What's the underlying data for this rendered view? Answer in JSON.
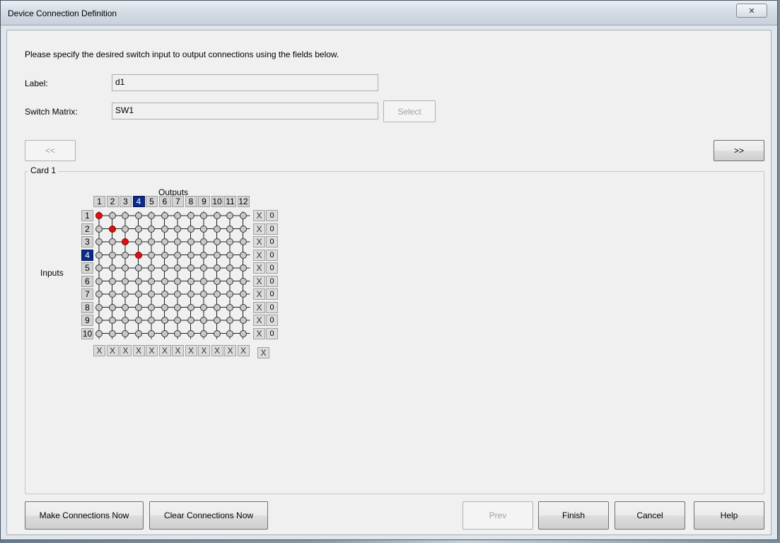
{
  "window": {
    "title": "Device Connection Definition",
    "close_glyph": "✕"
  },
  "instruction": "Please specify the desired switch input to output connections using the fields below.",
  "form": {
    "label_caption": "Label:",
    "label_value": "d1",
    "switch_caption": "Switch Matrix:",
    "switch_value": "SW1",
    "select_button": "Select"
  },
  "nav": {
    "prev_card": "<<",
    "next_card": ">>"
  },
  "card": {
    "title": "Card 1",
    "outputs_label": "Outputs",
    "inputs_label": "Inputs",
    "outputs": [
      "1",
      "2",
      "3",
      "4",
      "5",
      "6",
      "7",
      "8",
      "9",
      "10",
      "11",
      "12"
    ],
    "inputs": [
      "1",
      "2",
      "3",
      "4",
      "5",
      "6",
      "7",
      "8",
      "9",
      "10"
    ],
    "selected_output": "4",
    "selected_input": "4",
    "row_counts": [
      "0",
      "0",
      "0",
      "0",
      "0",
      "0",
      "0",
      "0",
      "0",
      "0"
    ],
    "clear_glyph": "X",
    "connections": [
      [
        1,
        1
      ],
      [
        2,
        2
      ],
      [
        3,
        3
      ],
      [
        4,
        4
      ]
    ]
  },
  "footer": {
    "make_connections": "Make Connections Now",
    "clear_connections": "Clear Connections Now",
    "prev": "Prev",
    "finish": "Finish",
    "cancel": "Cancel",
    "help": "Help"
  },
  "colors": {
    "connected": "#e01010",
    "selected_header": "#0b2a8a",
    "node": "#c8c8c8"
  }
}
